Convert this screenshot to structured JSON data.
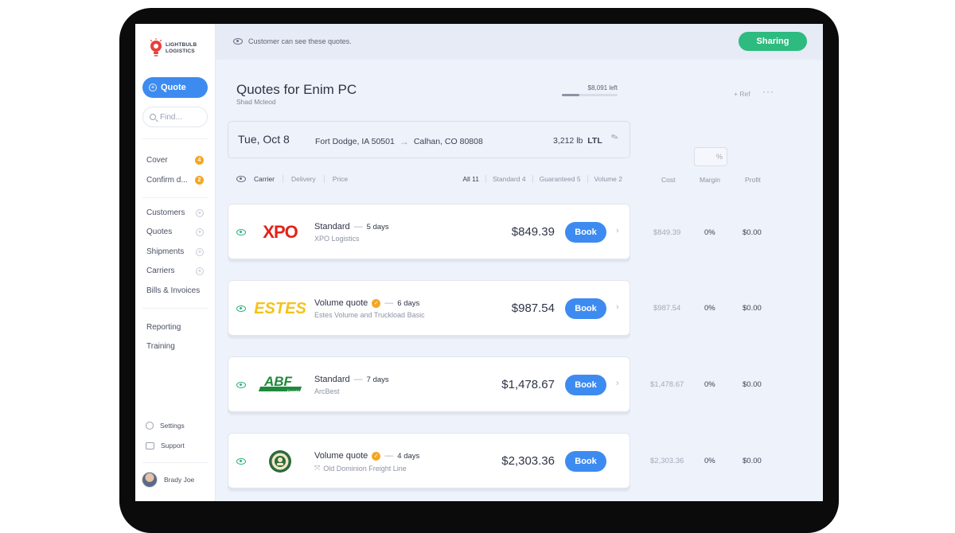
{
  "app": {
    "logo_line1": "LIGHTBULB",
    "logo_line2": "LOGISTICS",
    "brand_color": "#e8403a",
    "accent_color": "#3d8bf0",
    "success_color": "#2dbb7f"
  },
  "sidebar": {
    "quote_button": "Quote",
    "find_placeholder": "Find...",
    "task_items": [
      {
        "label": "Cover",
        "count": "4"
      },
      {
        "label": "Confirm d...",
        "count": "2"
      }
    ],
    "nav_items": [
      "Customers",
      "Quotes",
      "Shipments",
      "Carriers",
      "Bills & Invoices"
    ],
    "secondary_items": [
      "Reporting",
      "Training"
    ],
    "settings": "Settings",
    "support": "Support",
    "user_name": "Brady Joe"
  },
  "topbar": {
    "visibility_note": "Customer can see these quotes.",
    "sharing_button": "Sharing"
  },
  "header": {
    "title": "Quotes for Enim PC",
    "subtitle": "Shad Mcleod",
    "budget_label": "$8,091 left",
    "budget_used_fraction": 0.32,
    "ref_button": "+ Ref",
    "more_button": "···"
  },
  "shipment": {
    "date": "Tue, Oct 8",
    "origin": "Fort Dodge, IA 50501",
    "destination": "Calhan, CO 80808",
    "weight": "3,212 lb",
    "mode": "LTL"
  },
  "margin_input": {
    "placeholder": "%"
  },
  "filters": {
    "sort_options": [
      "Carrier",
      "Delivery",
      "Price"
    ],
    "groups": [
      "All 11",
      "Standard 4",
      "Guaranteed 5",
      "Volume 2"
    ]
  },
  "columns": {
    "cost": "Cost",
    "margin": "Margin",
    "profit": "Profit"
  },
  "quotes": [
    {
      "logo": "XPO",
      "service": "Standard",
      "days": "5 days",
      "carrier": "XPO Logistics",
      "price": "$849.39",
      "book": "Book",
      "cost": "$849.39",
      "margin": "0%",
      "profit": "$0.00",
      "volume": false
    },
    {
      "logo": "ESTES",
      "service": "Volume quote",
      "days": "6 days",
      "carrier": "Estes Volume and Truckload Basic",
      "price": "$987.54",
      "book": "Book",
      "cost": "$987.54",
      "margin": "0%",
      "profit": "$0.00",
      "volume": true
    },
    {
      "logo": "ABF",
      "logo_sub": "Freight",
      "service": "Standard",
      "days": "7 days",
      "carrier": "ArcBest",
      "price": "$1,478.67",
      "book": "Book",
      "cost": "$1,478.67",
      "margin": "0%",
      "profit": "$0.00",
      "volume": false
    },
    {
      "logo": "OD",
      "service": "Volume quote",
      "days": "4 days",
      "carrier": "Old Dominion Freight Line",
      "price": "$2,303.36",
      "book": "Book",
      "cost": "$2,303.36",
      "margin": "0%",
      "profit": "$0.00",
      "volume": true
    }
  ]
}
